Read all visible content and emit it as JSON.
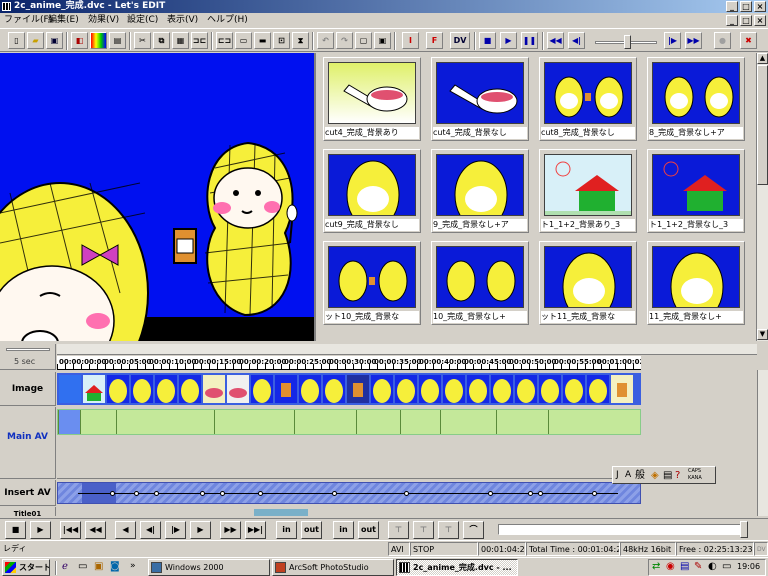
{
  "window": {
    "title": "2c_anime_完成.dvc - Let's EDIT",
    "buttons": [
      "_",
      "□",
      "×"
    ]
  },
  "menubar": {
    "window_buttons": [
      "_",
      "□",
      "×"
    ],
    "items": [
      "ファイル(F)",
      "編集(E)",
      "効果(V)",
      "設定(C)",
      "表示(V)",
      "ヘルプ(H)"
    ]
  },
  "toolbar": {
    "labels": [
      "DV",
      "IN",
      "OUT"
    ]
  },
  "thumbnails": [
    {
      "caption": "cut4_完成_背景あり"
    },
    {
      "caption": "cut4_完成_背景なし"
    },
    {
      "caption": "cut8_完成_背景なし"
    },
    {
      "caption": "8_完成_背景なし+ア"
    },
    {
      "caption": "cut9_完成_背景なし"
    },
    {
      "caption": "9_完成_背景なし+ア"
    },
    {
      "caption": "ト1_1+2_背景あり_3"
    },
    {
      "caption": "ト1_1+2_背景なし_3"
    },
    {
      "caption": "ット10_完成_背景な"
    },
    {
      "caption": "10_完成_背景なし+"
    },
    {
      "caption": "ット11_完成_背景な"
    },
    {
      "caption": "11_完成_背景なし+"
    }
  ],
  "timeline": {
    "zoom_label": "5 sec",
    "ruler_ticks": [
      "00:00:00:00",
      "00:00:05:00",
      "00:00:10:00",
      "00:00:15:00",
      "00:00:20:00",
      "00:00:25:00",
      "00:00:30:00",
      "00:00:35:00",
      "00:00:40:00",
      "00:00:45:00",
      "00:00:50:00",
      "00:00:55:00",
      "00:01:00:02"
    ],
    "tracks": {
      "image": "Image",
      "main_av": "Main AV",
      "insert_av": "Insert AV",
      "title": "Title01"
    }
  },
  "ime": {
    "items": [
      "J",
      "A",
      "般",
      "CAPS",
      "KANA"
    ]
  },
  "transport": {
    "in_label": "in",
    "out_label": "out"
  },
  "statusbar": {
    "ready": "レディ",
    "format": "AVI",
    "state": "STOP",
    "current": "00:01:04:26",
    "total": "Total Time : 00:01:04:27",
    "audio": "48kHz 16bit",
    "free": "Free : 02:25:13:23",
    "indicator": "DV"
  },
  "taskbar": {
    "start": "スタート",
    "tasks": [
      {
        "label": "Windows 2000",
        "active": false
      },
      {
        "label": "ArcSoft PhotoStudio",
        "active": false
      },
      {
        "label": "2c_anime_完成.dvc - ...",
        "active": true
      }
    ],
    "clock": "19:06"
  },
  "colors": {
    "title_gradient_start": "#0a246a",
    "title_gradient_end": "#a6caf0",
    "preview_bg": "#0010f0",
    "main_av_clip": "#c4e89a",
    "insert_av_clip": "#7d93e4"
  }
}
